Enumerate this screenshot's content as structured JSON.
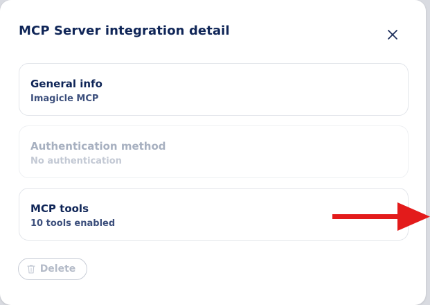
{
  "dialog": {
    "title": "MCP Server integration detail"
  },
  "cards": {
    "general_info": {
      "title": "General info",
      "subtitle": "Imagicle MCP"
    },
    "authentication": {
      "title": "Authentication method",
      "subtitle": "No authentication"
    },
    "mcp_tools": {
      "title": "MCP tools",
      "subtitle": "10 tools enabled"
    }
  },
  "actions": {
    "delete_label": "Delete"
  },
  "icons": {
    "close": "close-icon",
    "delete": "trash-icon",
    "annotation": "arrow-left-icon"
  },
  "colors": {
    "title": "#0f2557",
    "annotation_arrow": "#e31b1b"
  }
}
